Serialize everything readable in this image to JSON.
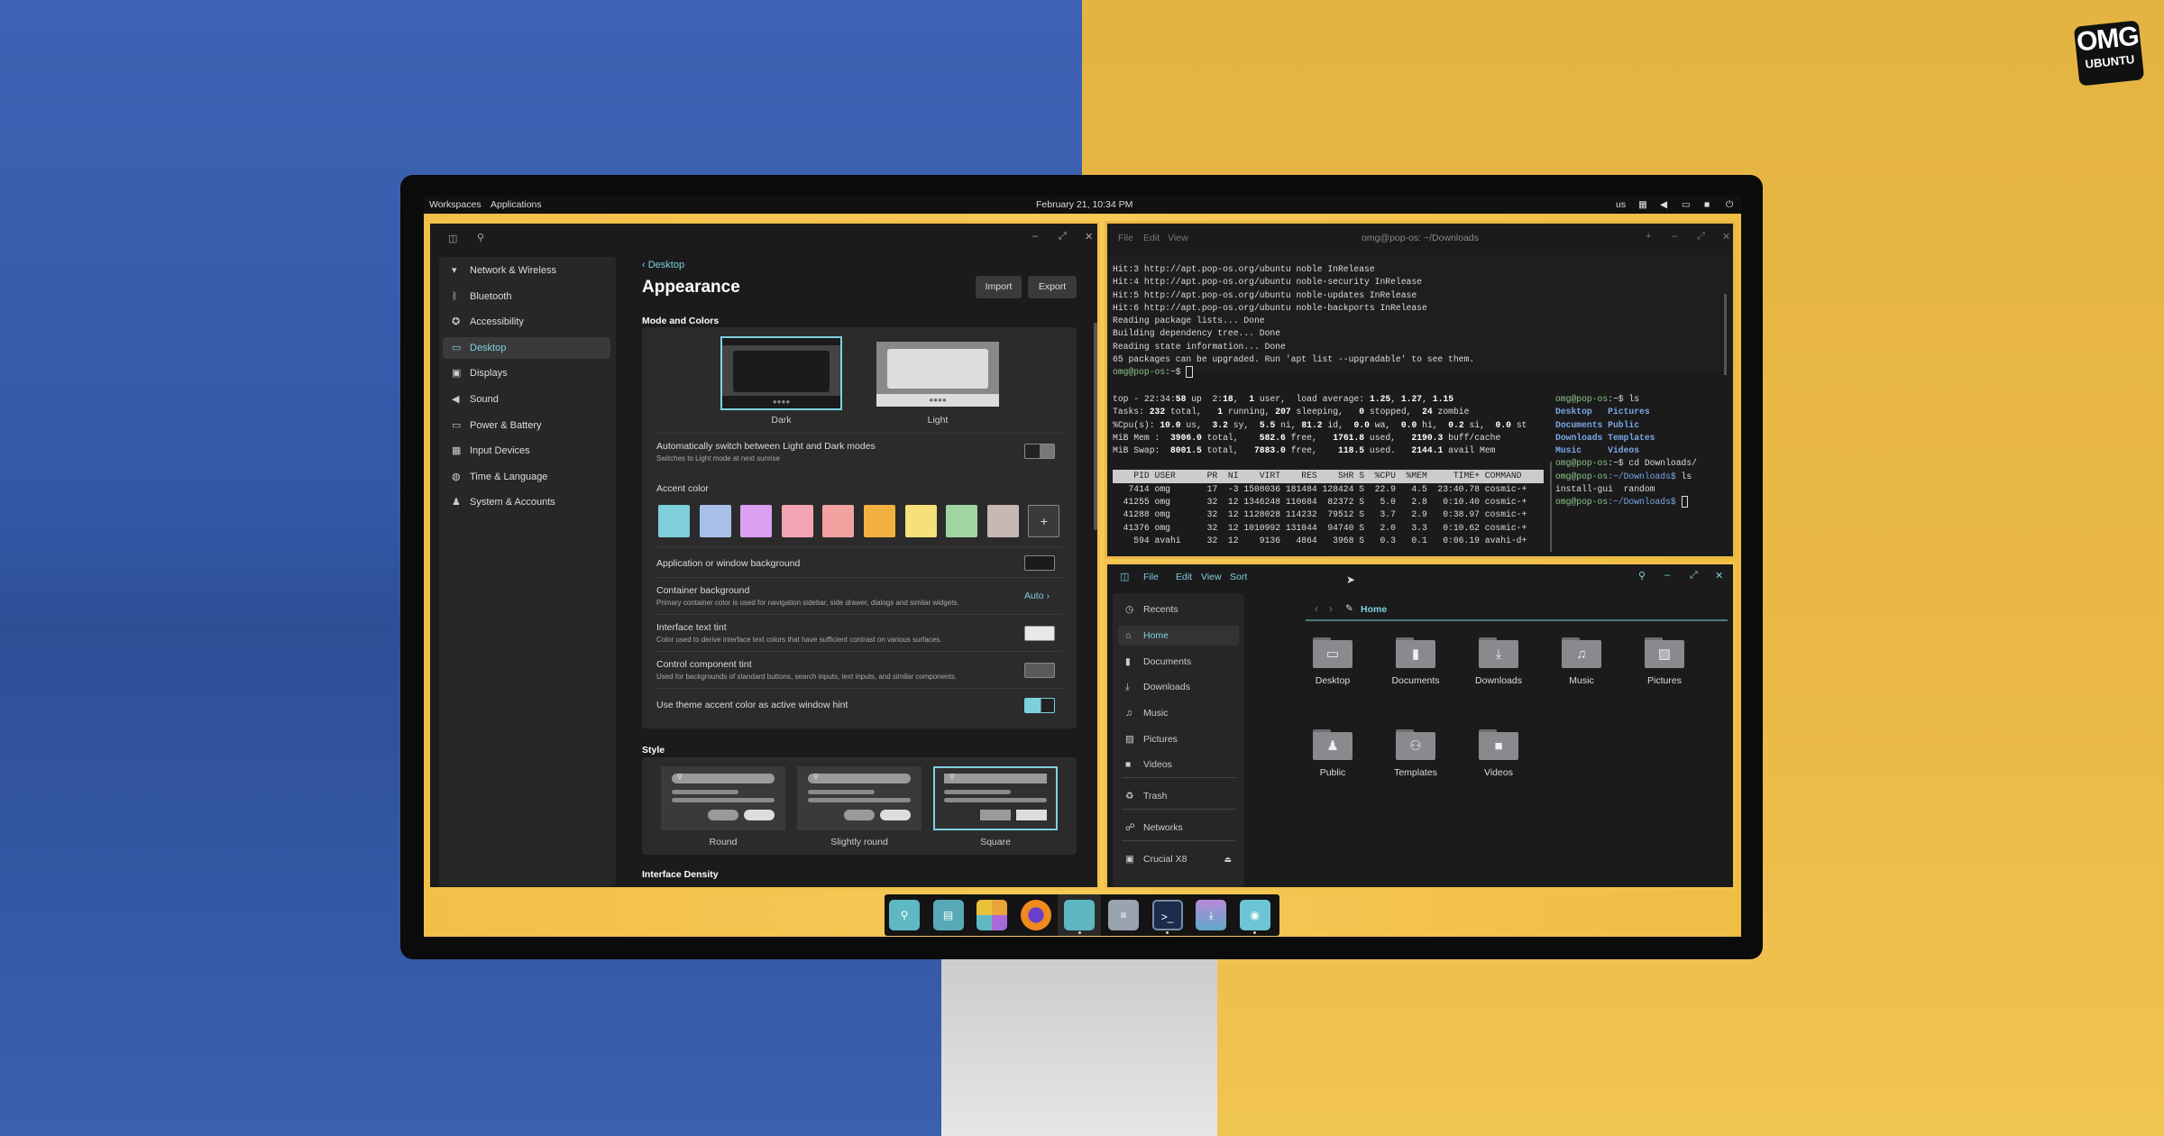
{
  "brand": {
    "logo_top": "OMG",
    "logo_bottom": "UBUNTU"
  },
  "panel": {
    "workspaces": "Workspaces",
    "applications": "Applications",
    "datetime": "February 21, 10:34 PM",
    "keyboard": "us",
    "icons": [
      "tiling-icon",
      "volume-icon",
      "battery-icon",
      "notifications-icon",
      "power-icon"
    ]
  },
  "settings": {
    "nav": [
      {
        "label": "Network & Wireless",
        "icon": "wifi-icon"
      },
      {
        "label": "Bluetooth",
        "icon": "bluetooth-icon"
      },
      {
        "label": "Accessibility",
        "icon": "accessibility-icon"
      },
      {
        "label": "Desktop",
        "icon": "desktop-icon",
        "active": true
      },
      {
        "label": "Displays",
        "icon": "display-icon"
      },
      {
        "label": "Sound",
        "icon": "sound-icon"
      },
      {
        "label": "Power & Battery",
        "icon": "battery-icon"
      },
      {
        "label": "Input Devices",
        "icon": "keyboard-icon"
      },
      {
        "label": "Time & Language",
        "icon": "globe-icon"
      },
      {
        "label": "System & Accounts",
        "icon": "users-icon"
      }
    ],
    "breadcrumb": "Desktop",
    "title": "Appearance",
    "import": "Import",
    "export": "Export",
    "mode_section": "Mode and Colors",
    "modes": [
      {
        "label": "Dark",
        "selected": true
      },
      {
        "label": "Light",
        "selected": false
      }
    ],
    "auto_switch": {
      "label": "Automatically switch between Light and Dark modes",
      "desc": "Switches to Light mode at next sunrise",
      "on": false
    },
    "accent_label": "Accent color",
    "accent_colors": [
      "#7fcfdd",
      "#a8bfea",
      "#dca0f2",
      "#f2a4b2",
      "#f2a2a0",
      "#f2b03e",
      "#f5e07a",
      "#a0d4a0",
      "#c8b8b4"
    ],
    "accent_add": "+",
    "rows": [
      {
        "label": "Application or window background",
        "color": "#1b1b1b"
      },
      {
        "label": "Container background",
        "desc": "Primary container color is used for navigation sidebar, side drawer, dialogs and similar widgets.",
        "value": "Auto"
      },
      {
        "label": "Interface text tint",
        "desc": "Color used to derive interface text colors that have sufficient contrast on various surfaces.",
        "color": "#e8e8e8"
      },
      {
        "label": "Control component tint",
        "desc": "Used for backgrounds of standard buttons, search inputs, text inputs, and similar components.",
        "color": "#5a5a5a"
      },
      {
        "label": "Use theme accent color as active window hint",
        "on": true
      }
    ],
    "style_section": "Style",
    "styles": [
      {
        "label": "Round"
      },
      {
        "label": "Slightly round"
      },
      {
        "label": "Square",
        "selected": true
      }
    ],
    "density_section": "Interface Density"
  },
  "terminal": {
    "menu": [
      "File",
      "Edit",
      "View"
    ],
    "title": "omg@pop-os: ~/Downloads",
    "top_lines": [
      "Hit:3 http://apt.pop-os.org/ubuntu noble InRelease",
      "Hit:4 http://apt.pop-os.org/ubuntu noble-security InRelease",
      "Hit:5 http://apt.pop-os.org/ubuntu noble-updates InRelease",
      "Hit:6 http://apt.pop-os.org/ubuntu noble-backports InRelease",
      "Reading package lists... Done",
      "Building dependency tree... Done",
      "Reading state information... Done",
      "65 packages can be upgraded. Run 'apt list --upgradable' to see them."
    ],
    "prompt_user": "omg@pop-os",
    "prompt_home": ":~$ ",
    "prompt_dl": ":~/Downloads$ ",
    "htop_summary": [
      "top - 22:34:58 up  2:18,  1 user,  load average: 1.25, 1.27, 1.15",
      "Tasks: 232 total,   1 running, 207 sleeping,   0 stopped,  24 zombie",
      "%Cpu(s): 10.0 us,  3.2 sy,  5.5 ni, 81.2 id,  0.0 wa,  0.0 hi,  0.2 si,  0.0 st",
      "MiB Mem :  3906.0 total,    582.6 free,   1761.8 used,   2190.3 buff/cache",
      "MiB Swap:  8001.5 total,   7883.0 free,    118.5 used.   2144.1 avail Mem"
    ],
    "htop_header": "    PID USER      PR  NI    VIRT    RES    SHR S  %CPU  %MEM     TIME+ COMMAND",
    "htop_rows": [
      "   7414 omg       17  -3 1508036 181484 128424 S  22.9   4.5  23:40.78 cosmic-+",
      "  41255 omg       32  12 1346248 110684  82372 S   5.0   2.8   0:10.40 cosmic-+",
      "  41288 omg       32  12 1128028 114232  79512 S   3.7   2.9   0:38.97 cosmic-+",
      "  41376 omg       32  12 1010992 131044  94740 S   2.0   3.3   0:10.62 cosmic-+",
      "    594 avahi     32  12    9136   4864   3968 S   0.3   0.1   0:06.19 avahi-d+"
    ],
    "right_pane": {
      "cmd1": "ls",
      "ls_dirs": [
        [
          "Desktop",
          "Pictures"
        ],
        [
          "Documents",
          "Public"
        ],
        [
          "Downloads",
          "Templates"
        ],
        [
          "Music",
          "Videos"
        ]
      ],
      "cmd2": "cd Downloads/",
      "cmd3": "ls",
      "ls_files": "install-gui  random"
    }
  },
  "files": {
    "menu": [
      "File",
      "Edit",
      "View",
      "Sort"
    ],
    "sidebar": [
      {
        "label": "Recents",
        "icon": "clock-icon"
      },
      {
        "label": "Home",
        "icon": "home-icon",
        "active": true
      },
      {
        "label": "Documents",
        "icon": "document-icon"
      },
      {
        "label": "Downloads",
        "icon": "download-icon"
      },
      {
        "label": "Music",
        "icon": "music-icon"
      },
      {
        "label": "Pictures",
        "icon": "picture-icon"
      },
      {
        "label": "Videos",
        "icon": "video-icon"
      },
      {
        "label": "Trash",
        "icon": "trash-icon"
      },
      {
        "label": "Networks",
        "icon": "network-icon"
      },
      {
        "label": "Crucial X8",
        "icon": "drive-icon"
      }
    ],
    "location": "Home",
    "folders": [
      {
        "label": "Desktop",
        "icon": "desktop-icon"
      },
      {
        "label": "Documents",
        "icon": "document-icon"
      },
      {
        "label": "Downloads",
        "icon": "download-icon"
      },
      {
        "label": "Music",
        "icon": "music-icon"
      },
      {
        "label": "Pictures",
        "icon": "picture-icon"
      },
      {
        "label": "Public",
        "icon": "users-icon"
      },
      {
        "label": "Templates",
        "icon": "templates-icon"
      },
      {
        "label": "Videos",
        "icon": "video-icon"
      }
    ]
  },
  "dock": [
    {
      "name": "launcher",
      "icon": "launcher-icon",
      "running": false
    },
    {
      "name": "workspaces",
      "icon": "workspaces-icon",
      "running": false
    },
    {
      "name": "app-library",
      "icon": "app-grid-icon",
      "running": false
    },
    {
      "name": "firefox",
      "icon": "firefox-icon",
      "running": false
    },
    {
      "name": "files",
      "icon": "folder-icon",
      "running": true
    },
    {
      "name": "text-editor",
      "icon": "text-editor-icon",
      "running": false
    },
    {
      "name": "terminal",
      "icon": "terminal-icon",
      "running": true
    },
    {
      "name": "store",
      "icon": "store-icon",
      "running": false
    },
    {
      "name": "settings",
      "icon": "settings-icon",
      "running": true
    }
  ],
  "colors": {
    "accent": "#7fd0df",
    "window_hint": "#f2c14c"
  }
}
